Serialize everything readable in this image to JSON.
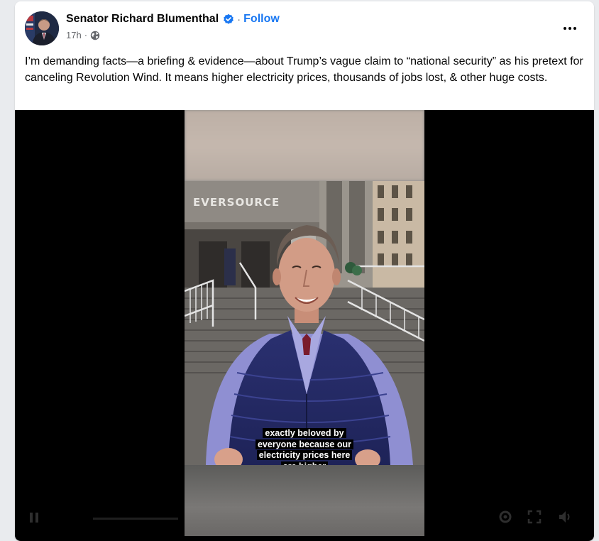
{
  "post": {
    "author": "Senator Richard Blumenthal",
    "separator": "·",
    "follow_label": "Follow",
    "timestamp": "17h",
    "meta_separator": "·",
    "privacy_icon": "globe-icon",
    "verified_icon": "verified-badge-icon",
    "more_icon": "more-options-icon",
    "text": "I’m demanding facts—a briefing & evidence—about Trump’s vague claim to “national security” as his pretext for canceling Revolution Wind. It means higher electricity prices, thousands of jobs lost, & other huge costs."
  },
  "video": {
    "building_sign": "EVERSOURCE",
    "caption": "exactly beloved by everyone because our electricity prices here are higher",
    "controls": {
      "play_icon": "play-icon",
      "settings_icon": "gear-icon",
      "fullscreen_icon": "fullscreen-icon",
      "volume_icon": "volume-icon"
    }
  },
  "colors": {
    "accent": "#1877f2",
    "text": "#050505",
    "secondary_text": "#65676b",
    "card_background": "#ffffff",
    "page_background": "#e9ebee",
    "video_background": "#000000"
  }
}
